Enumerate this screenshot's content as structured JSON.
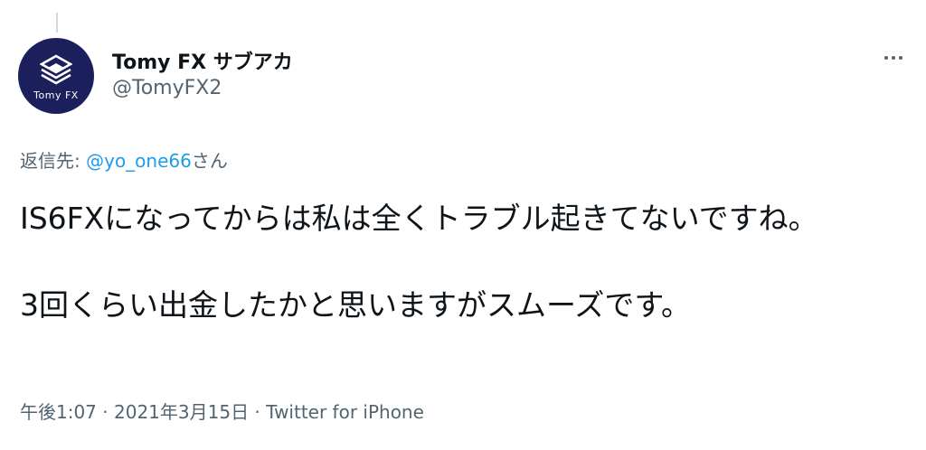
{
  "author": {
    "display_name": "Tomy FX サブアカ",
    "handle": "@TomyFX2",
    "avatar_text": "Tomy FX",
    "avatar_color": "#1b1f5c"
  },
  "reply": {
    "prefix": "返信先: ",
    "mention": "@yo_one66",
    "suffix": "さん"
  },
  "tweet": {
    "paragraph_1": "IS6FXになってからは私は全くトラブル起きてないですね。",
    "paragraph_2": "3回くらい出金したかと思いますがスムーズです。"
  },
  "meta": {
    "time": "午後1:07",
    "separator": " · ",
    "date": "2021年3月15日",
    "source": "Twitter for iPhone"
  },
  "colors": {
    "text_primary": "#0f1419",
    "text_secondary": "#536471",
    "link": "#1d9bf0"
  },
  "icons": {
    "more": "more-dots-icon",
    "logo": "tomyfx-logo-icon"
  }
}
